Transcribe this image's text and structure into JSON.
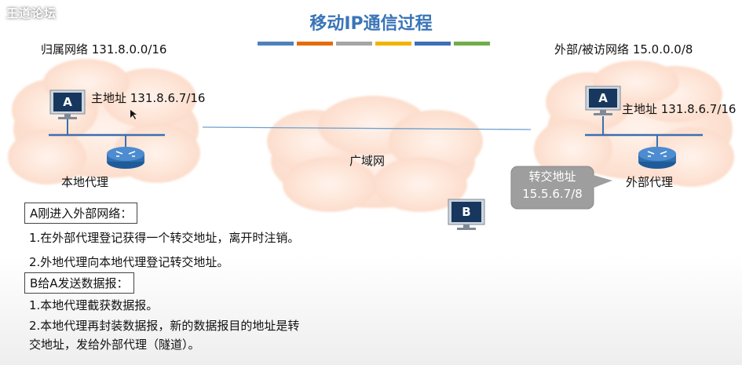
{
  "watermark": "王道论坛",
  "title": "移动IP通信过程",
  "title_bar_colors": [
    "#4f81bd",
    "#e46c0a",
    "#a5a5a5",
    "#f0b400",
    "#3f6fb5",
    "#70ad47"
  ],
  "home_network_label": "归属网络 131.8.0.0/16",
  "foreign_network_label": "外部/被访网络 15.0.0.0/8",
  "host_a_left": {
    "letter": "A",
    "address_label": "主地址 131.8.6.7/16"
  },
  "host_a_right": {
    "letter": "A",
    "address_label": "主地址 131.8.6.7/16"
  },
  "host_b": {
    "letter": "B"
  },
  "home_agent_label": "本地代理",
  "foreign_agent_label": "外部代理",
  "wan_label": "广域网",
  "care_of_address": {
    "line1": "转交地址",
    "line2": "15.5.6.7/8"
  },
  "section_a": {
    "heading": "A刚进入外部网络：",
    "items": [
      "1.在外部代理登记获得一个转交地址，离开时注销。",
      "2.外地代理向本地代理登记转交地址。"
    ]
  },
  "section_b": {
    "heading": "B给A发送数据报：",
    "items": [
      "1.本地代理截获数据报。",
      "2.本地代理再封装数据报，新的数据报目的地址是转",
      "交地址，发给外部代理（隧道）。"
    ]
  },
  "colors": {
    "title": "#3a74b8",
    "cloud_fill": "#fde6d9",
    "cloud_edge": "#f2b8a0",
    "router": "#2f6fb0",
    "monitor": "#17375e",
    "callout": "#9e9e9e"
  }
}
